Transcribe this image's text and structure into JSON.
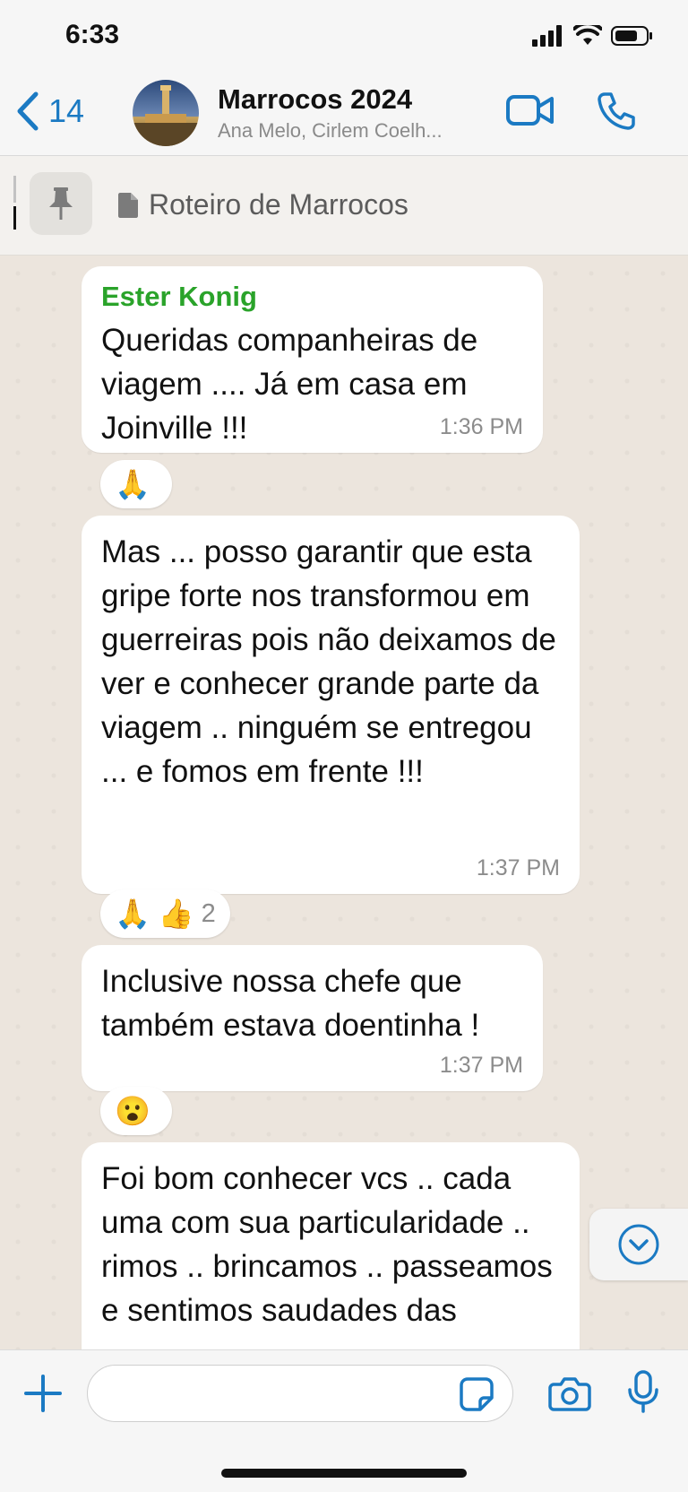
{
  "status_bar": {
    "time": "6:33"
  },
  "header": {
    "back_count": "14",
    "title": "Marrocos 2024",
    "subtitle": "Ana Melo, Cirlem Coelh..."
  },
  "pinned": {
    "text": "Roteiro de Marrocos"
  },
  "messages": [
    {
      "sender": "Ester Konig",
      "text": "Queridas companheiras de viagem .... Já em casa em Joinville !!!",
      "time": "1:36 PM",
      "reactions": "🙏",
      "reaction_count": ""
    },
    {
      "sender": "",
      "text": "Mas ... posso garantir que esta gripe forte nos transformou em guerreiras pois não deixamos de ver e conhecer grande parte da viagem .. ninguém se entregou ... e fomos em frente !!!",
      "time": "1:37 PM",
      "reactions": "🙏 👍",
      "reaction_count": "2"
    },
    {
      "sender": "",
      "text": "Inclusive nossa chefe que também estava doentinha !",
      "time": "1:37 PM",
      "reactions": "😮",
      "reaction_count": ""
    },
    {
      "sender": "",
      "text": "Foi bom conhecer vcs .. cada uma com sua particularidade .. rimos .. brincamos .. passeamos e sentimos saudades das",
      "time": "",
      "reactions": "",
      "reaction_count": ""
    }
  ],
  "composer": {
    "placeholder": ""
  },
  "icons": {
    "back": "chevron-left-icon",
    "video": "video-camera-icon",
    "call": "phone-icon",
    "pin": "pin-icon",
    "document": "document-icon",
    "scroll_down": "chevron-down-circle-icon",
    "plus": "plus-icon",
    "sticker": "sticker-icon",
    "camera": "camera-icon",
    "mic": "microphone-icon"
  },
  "colors": {
    "accent": "#1b7ac3",
    "sender": "#2aa32a",
    "chat_background": "#ece5dd"
  }
}
